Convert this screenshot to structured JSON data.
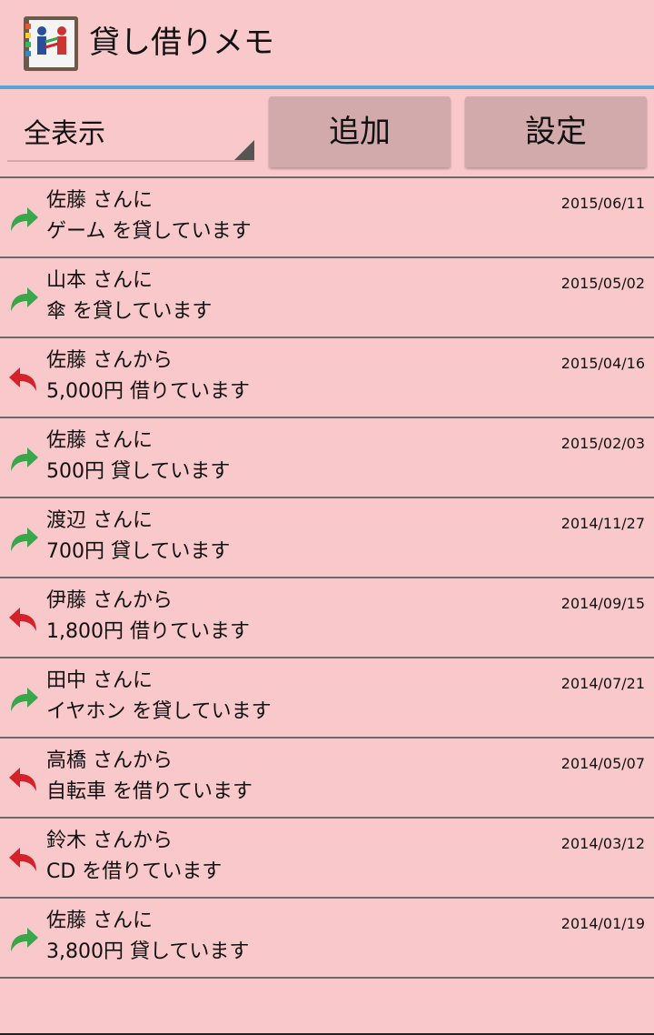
{
  "app": {
    "title": "貸し借りメモ"
  },
  "toolbar": {
    "filter_selected": "全表示",
    "add_label": "追加",
    "settings_label": "設定"
  },
  "colors": {
    "lend": "#3aa64a",
    "borrow": "#d4222a",
    "accent": "#56a6d3"
  },
  "entries": [
    {
      "type": "lend",
      "icon": "lend-arrow-icon",
      "line1": "佐藤 さんに",
      "line2": "ゲーム を貸しています",
      "date": "2015/06/11"
    },
    {
      "type": "lend",
      "icon": "lend-arrow-icon",
      "line1": "山本 さんに",
      "line2": "傘 を貸しています",
      "date": "2015/05/02"
    },
    {
      "type": "borrow",
      "icon": "borrow-arrow-icon",
      "line1": "佐藤 さんから",
      "line2": "5,000円 借りています",
      "date": "2015/04/16"
    },
    {
      "type": "lend",
      "icon": "lend-arrow-icon",
      "line1": "佐藤 さんに",
      "line2": "500円 貸しています",
      "date": "2015/02/03"
    },
    {
      "type": "lend",
      "icon": "lend-arrow-icon",
      "line1": "渡辺 さんに",
      "line2": "700円 貸しています",
      "date": "2014/11/27"
    },
    {
      "type": "borrow",
      "icon": "borrow-arrow-icon",
      "line1": "伊藤 さんから",
      "line2": "1,800円 借りています",
      "date": "2014/09/15"
    },
    {
      "type": "lend",
      "icon": "lend-arrow-icon",
      "line1": "田中 さんに",
      "line2": "イヤホン を貸しています",
      "date": "2014/07/21"
    },
    {
      "type": "borrow",
      "icon": "borrow-arrow-icon",
      "line1": "高橋 さんから",
      "line2": "自転車 を借りています",
      "date": "2014/05/07"
    },
    {
      "type": "borrow",
      "icon": "borrow-arrow-icon",
      "line1": "鈴木 さんから",
      "line2": "CD を借りています",
      "date": "2014/03/12"
    },
    {
      "type": "lend",
      "icon": "lend-arrow-icon",
      "line1": "佐藤 さんに",
      "line2": "3,800円 貸しています",
      "date": "2014/01/19"
    }
  ]
}
